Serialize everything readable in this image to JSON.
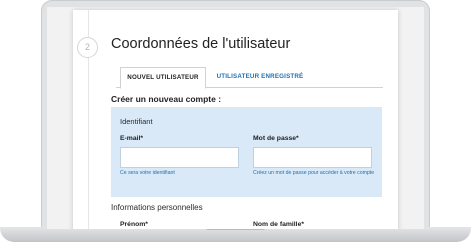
{
  "step": {
    "number": "2"
  },
  "page": {
    "title": "Coordonnées de l'utilisateur"
  },
  "tabs": [
    {
      "label": "NOUVEL UTILISATEUR",
      "active": true
    },
    {
      "label": "UTILISATEUR ENREGISTRÉ",
      "active": false
    }
  ],
  "form": {
    "section_title": "Créer un nouveau compte :",
    "identifiant": {
      "title": "Identifiant",
      "email": {
        "label": "E-mail*",
        "value": "",
        "hint": "Ce sera votre identifiant"
      },
      "password": {
        "label": "Mot de passe*",
        "value": "",
        "hint": "Créez un mot de passe pour accéder à votre compte"
      }
    },
    "personal": {
      "title": "Informations personnelles",
      "firstname_label": "Prénom*",
      "lastname_label": "Nom de famille*"
    }
  },
  "colors": {
    "accent": "#1f6fb2",
    "panel_background": "#d9e9f7",
    "laptop_frame": "#e1e2e4"
  }
}
